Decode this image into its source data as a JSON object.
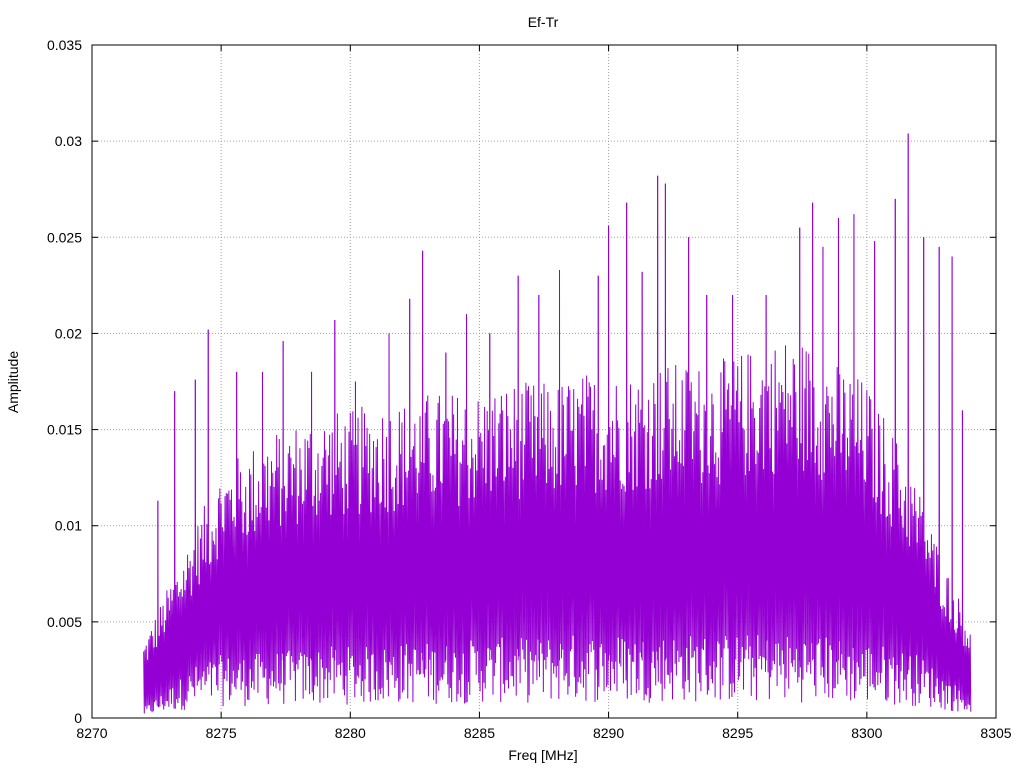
{
  "chart_data": {
    "type": "line",
    "title": "Ef-Tr",
    "xlabel": "Freq [MHz]",
    "ylabel": "Amplitude",
    "xlim": [
      8270,
      8305
    ],
    "ylim": [
      0,
      0.035
    ],
    "x_ticks": [
      "8270",
      "8275",
      "8280",
      "8285",
      "8290",
      "8295",
      "8300",
      "8305"
    ],
    "y_ticks": [
      "0",
      "0.005",
      "0.01",
      "0.015",
      "0.02",
      "0.025",
      "0.03",
      "0.035"
    ],
    "grid": true,
    "series": [
      {
        "color": "#9400d3",
        "x_range": [
          8272.0,
          8304.0
        ],
        "x_step": 0.05,
        "band_upper": [
          0.004,
          0.007,
          0.01,
          0.013,
          0.014,
          0.015,
          0.0155,
          0.016,
          0.016,
          0.0165,
          0.0165,
          0.017,
          0.017,
          0.017,
          0.0175,
          0.0175,
          0.0175,
          0.018,
          0.018,
          0.018,
          0.0185,
          0.0185,
          0.0185,
          0.019,
          0.0195,
          0.02,
          0.0195,
          0.0185,
          0.0175,
          0.015,
          0.012,
          0.008,
          0.005
        ],
        "band_lower": [
          0.0005,
          0.0015,
          0.0025,
          0.003,
          0.003,
          0.0032,
          0.0032,
          0.0034,
          0.0034,
          0.0034,
          0.0036,
          0.0036,
          0.0036,
          0.0038,
          0.0038,
          0.0038,
          0.004,
          0.004,
          0.004,
          0.004,
          0.004,
          0.004,
          0.004,
          0.004,
          0.004,
          0.004,
          0.004,
          0.0038,
          0.0036,
          0.0034,
          0.003,
          0.002,
          0.001
        ],
        "peaks": [
          [
            8272.55,
            0.0113
          ],
          [
            8273.2,
            0.017
          ],
          [
            8274.0,
            0.0176
          ],
          [
            8274.5,
            0.0202
          ],
          [
            8275.6,
            0.018
          ],
          [
            8276.6,
            0.018
          ],
          [
            8277.4,
            0.0196
          ],
          [
            8278.5,
            0.018
          ],
          [
            8279.4,
            0.0207
          ],
          [
            8280.2,
            0.0175
          ],
          [
            8281.5,
            0.02
          ],
          [
            8282.3,
            0.0218
          ],
          [
            8282.8,
            0.0243
          ],
          [
            8283.7,
            0.019
          ],
          [
            8284.5,
            0.021
          ],
          [
            8285.4,
            0.02
          ],
          [
            8286.5,
            0.023
          ],
          [
            8287.3,
            0.022
          ],
          [
            8288.1,
            0.0233
          ],
          [
            8289.6,
            0.023
          ],
          [
            8290.0,
            0.0256
          ],
          [
            8290.7,
            0.0268
          ],
          [
            8291.3,
            0.0232
          ],
          [
            8291.9,
            0.0282
          ],
          [
            8292.2,
            0.0278
          ],
          [
            8293.1,
            0.025
          ],
          [
            8293.8,
            0.022
          ],
          [
            8294.8,
            0.022
          ],
          [
            8296.1,
            0.022
          ],
          [
            8297.4,
            0.0255
          ],
          [
            8297.9,
            0.0268
          ],
          [
            8298.3,
            0.0245
          ],
          [
            8298.9,
            0.026
          ],
          [
            8299.5,
            0.0262
          ],
          [
            8300.3,
            0.0248
          ],
          [
            8301.1,
            0.027
          ],
          [
            8301.6,
            0.0304
          ],
          [
            8302.2,
            0.025
          ],
          [
            8302.8,
            0.0245
          ],
          [
            8303.3,
            0.024
          ],
          [
            8303.7,
            0.016
          ]
        ]
      }
    ]
  }
}
